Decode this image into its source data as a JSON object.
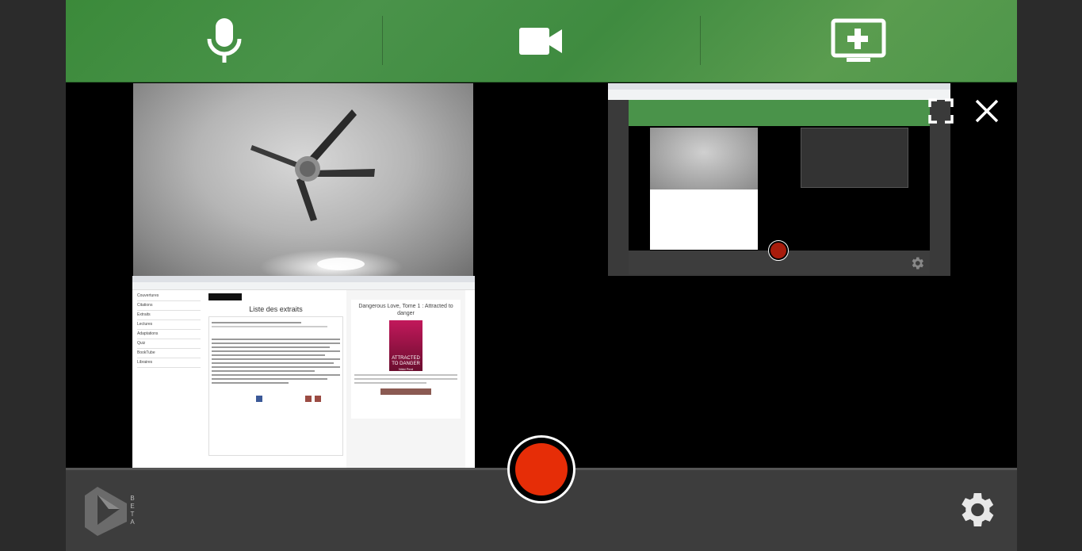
{
  "toolbar": {
    "buttons": [
      {
        "icon": "microphone-icon"
      },
      {
        "icon": "video-camera-icon"
      },
      {
        "icon": "add-screen-icon"
      }
    ]
  },
  "screen_capture": {
    "page_title": "Liste des extraits",
    "sidebar_items": [
      "Couvertures",
      "Citations",
      "Extraits",
      "Lectures",
      "Adaptations",
      "Quiz",
      "BookTube",
      "Libraires"
    ],
    "book_title": "Dangerous Love, Tome 1 : Attracted to danger",
    "cover_title": "ATTRACTED TO DANGER",
    "cover_author": "Nikki Pent"
  },
  "preview": {},
  "bottom": {
    "beta_label": "BETA"
  },
  "colors": {
    "toolbar": "#4a934a",
    "record": "#e62d07",
    "bottom": "#3d3d3d"
  }
}
